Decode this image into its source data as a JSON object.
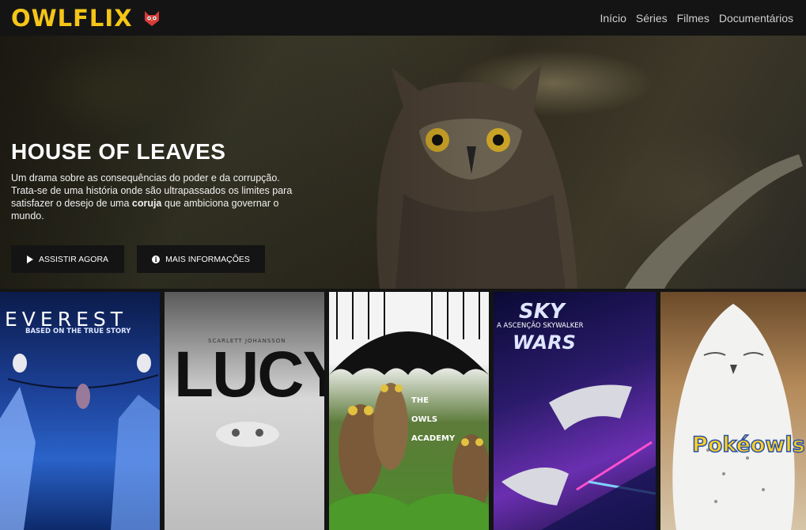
{
  "brand": {
    "name": "OWLFLIX",
    "logo_icon": "owl-logo-icon"
  },
  "nav": {
    "items": [
      "Início",
      "Séries",
      "Filmes",
      "Documentários"
    ]
  },
  "hero": {
    "title": "HOUSE OF LEAVES",
    "description_before": "Um drama sobre as consequências do poder e da corrupção. Trata-se de uma história onde são ultrapassados os limites para satisfazer o desejo de uma ",
    "description_bold": "coruja",
    "description_after": " que ambiciona governar o mundo.",
    "play_label": "ASSISTIR AGORA",
    "info_label": "MAIS INFORMAÇÕES"
  },
  "posters": [
    {
      "title": "EVEREST",
      "subtitle": "BASED ON THE TRUE STORY"
    },
    {
      "title": "LUCY",
      "credit": "SCARLETT JOHANSSON"
    },
    {
      "title_lines": [
        "THE",
        "OWLS",
        "ACADEMY"
      ]
    },
    {
      "title_top": "SKY",
      "subtitle": "A ASCENÇÃO SKYWALKER",
      "title_bottom": "WARS"
    },
    {
      "title": "Pokéowls"
    }
  ],
  "colors": {
    "brand": "#f5c518",
    "background": "#141414",
    "button": "#141414"
  }
}
